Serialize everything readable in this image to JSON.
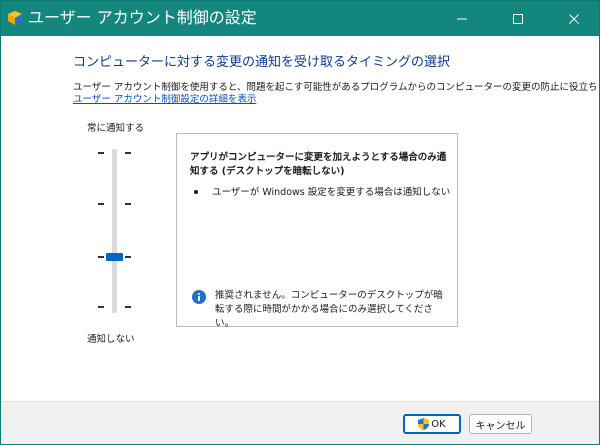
{
  "window": {
    "title": "ユーザー アカウント制御の設定",
    "controls": {
      "minimize": "minimize-icon",
      "maximize": "maximize-icon",
      "close": "close-icon"
    }
  },
  "content": {
    "heading": "コンピューターに対する変更の通知を受け取るタイミングの選択",
    "description": "ユーザー アカウント制御を使用すると、問題を起こす可能性があるプログラムからのコンピューターの変更の防止に役立ちます。",
    "link": "ユーザー アカウント制御設定の詳細を表示"
  },
  "slider": {
    "top_label": "常に通知する",
    "bottom_label": "通知しない",
    "levels": 4,
    "selected_level": 2
  },
  "info": {
    "title": "アプリがコンピューターに変更を加えようとする場合のみ通知する (デスクトップを暗転しない)",
    "bullets": [
      "ユーザーが Windows 設定を変更する場合は通知しない"
    ],
    "note": "推奨されません。コンピューターのデスクトップが暗転する際に時間がかかる場合にのみ選択してください。",
    "note_icon": "info-icon"
  },
  "buttons": {
    "ok": "OK",
    "cancel": "キャンセル"
  },
  "colors": {
    "titlebar": "#13877d",
    "heading": "#0b3a8c",
    "link": "#0a4fbf",
    "accent": "#0067c0"
  }
}
